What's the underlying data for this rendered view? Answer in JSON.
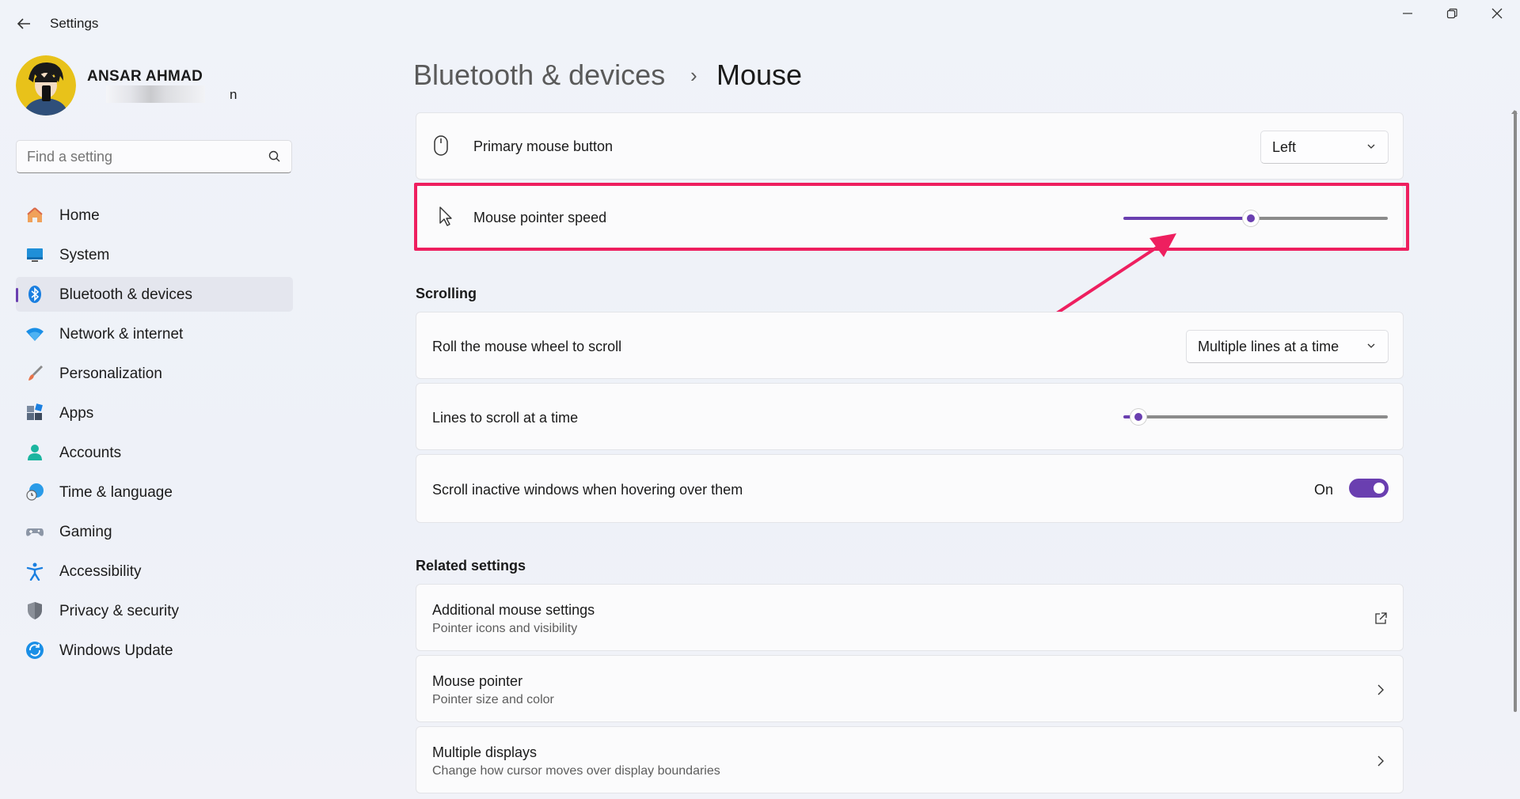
{
  "window": {
    "title": "Settings"
  },
  "profile": {
    "name": "ANSAR AHMAD",
    "email_tail": "n"
  },
  "search": {
    "placeholder": "Find a setting"
  },
  "nav": [
    {
      "label": "Home",
      "icon": "home-icon"
    },
    {
      "label": "System",
      "icon": "monitor-icon"
    },
    {
      "label": "Bluetooth & devices",
      "icon": "bluetooth-icon",
      "active": true
    },
    {
      "label": "Network & internet",
      "icon": "wifi-icon"
    },
    {
      "label": "Personalization",
      "icon": "brush-icon"
    },
    {
      "label": "Apps",
      "icon": "apps-icon"
    },
    {
      "label": "Accounts",
      "icon": "person-icon"
    },
    {
      "label": "Time & language",
      "icon": "globe-clock-icon"
    },
    {
      "label": "Gaming",
      "icon": "gamepad-icon"
    },
    {
      "label": "Accessibility",
      "icon": "accessibility-icon"
    },
    {
      "label": "Privacy & security",
      "icon": "shield-icon"
    },
    {
      "label": "Windows Update",
      "icon": "update-icon"
    }
  ],
  "breadcrumb": {
    "parent": "Bluetooth & devices",
    "separator": "›",
    "current": "Mouse"
  },
  "primary_button": {
    "label": "Primary mouse button",
    "value": "Left"
  },
  "pointer_speed": {
    "label": "Mouse pointer speed",
    "value_fraction": 0.48
  },
  "scrolling": {
    "heading": "Scrolling",
    "roll_wheel": {
      "label": "Roll the mouse wheel to scroll",
      "value": "Multiple lines at a time"
    },
    "lines": {
      "label": "Lines to scroll at a time",
      "value_fraction": 0.03
    },
    "inactive": {
      "label": "Scroll inactive windows when hovering over them",
      "state": "On"
    }
  },
  "related": {
    "heading": "Related settings",
    "items": [
      {
        "title": "Additional mouse settings",
        "subtitle": "Pointer icons and visibility",
        "icon": "external-link-icon"
      },
      {
        "title": "Mouse pointer",
        "subtitle": "Pointer size and color",
        "icon": "chevron-right-icon"
      },
      {
        "title": "Multiple displays",
        "subtitle": "Change how cursor moves over display boundaries",
        "icon": "chevron-right-icon"
      }
    ]
  },
  "colors": {
    "accent": "#6a3fb0",
    "highlight": "#ee1f5f"
  }
}
